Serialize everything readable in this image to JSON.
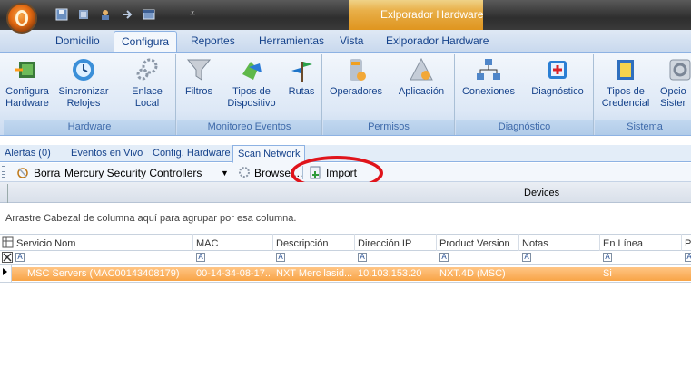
{
  "window": {
    "title": "Exlporador Hardware",
    "quick_access_icons": [
      "save-icon",
      "undo-icon",
      "user-icon",
      "forward-icon",
      "window-icon"
    ]
  },
  "menu_tabs": [
    "Domicilio",
    "Configura",
    "Reportes",
    "Herramientas",
    "Vista",
    "Exlporador Hardware"
  ],
  "active_menu_tab": "Configura",
  "ribbon": {
    "groups": [
      {
        "label": "Hardware",
        "buttons": [
          {
            "label": "Configura\nHardware",
            "icon": "hardware-config-icon"
          },
          {
            "label": "Sincronizar\nRelojes",
            "icon": "sync-clocks-icon"
          },
          {
            "label": "Enlace\nLocal",
            "icon": "link-gears-icon"
          }
        ]
      },
      {
        "label": "Monitoreo Eventos",
        "buttons": [
          {
            "label": "Filtros",
            "icon": "filter-icon"
          },
          {
            "label": "Tipos de\nDispositivo",
            "icon": "device-types-icon"
          },
          {
            "label": "Rutas",
            "icon": "routes-icon"
          }
        ]
      },
      {
        "label": "Permisos",
        "buttons": [
          {
            "label": "Operadores",
            "icon": "operators-icon"
          },
          {
            "label": "Aplicación",
            "icon": "application-icon"
          }
        ]
      },
      {
        "label": "Diagnóstico",
        "buttons": [
          {
            "label": "Conexiones",
            "icon": "connections-icon"
          },
          {
            "label": "Diagnóstico",
            "icon": "diagnostic-icon"
          }
        ]
      },
      {
        "label": "Sistema",
        "buttons": [
          {
            "label": "Tipos de\nCredencial",
            "icon": "credential-types-icon"
          },
          {
            "label": "Opcio\nSister",
            "icon": "system-options-icon"
          }
        ]
      }
    ]
  },
  "doc_tabs": [
    "Alertas (0)",
    "Eventos en Vivo",
    "Config. Hardware",
    "Scan Network"
  ],
  "active_doc_tab": "Scan Network",
  "toolbar": {
    "clear_label": "Borra",
    "controller_select_value": "Mercury Security Controllers",
    "browse_label": "Browse ...",
    "import_label": "Import"
  },
  "devices_title": "Devices",
  "group_hint": "Arrastre Cabezal de columna aquí para agrupar por esa columna.",
  "grid": {
    "columns": [
      "Servicio Nom",
      "MAC",
      "Descripción",
      "Dirección IP",
      "Product Version",
      "Notas",
      "En Línea",
      "P"
    ],
    "rows": [
      [
        "MSC Servers (MAC00143408179)",
        "00-14-34-08-17...",
        "NXT Merc lasid...",
        "10.103.153.20",
        "NXT.4D (MSC)",
        "",
        "Si",
        ""
      ]
    ]
  },
  "colors": {
    "accent": "#f8a447",
    "ribbon_text": "#15428b",
    "highlight_circle": "#e0141b"
  }
}
